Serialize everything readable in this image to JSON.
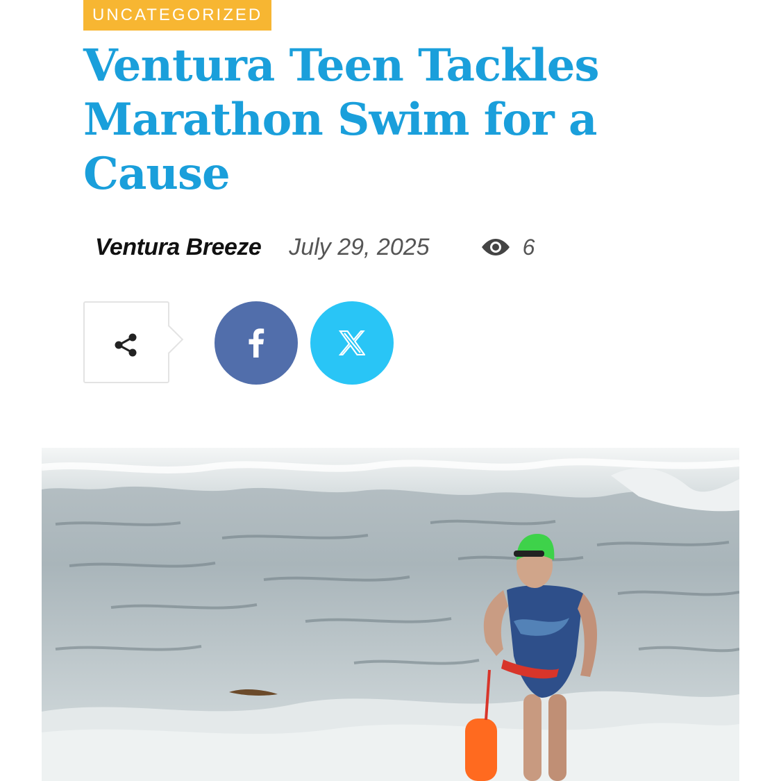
{
  "article": {
    "category": "UNCATEGORIZED",
    "title": "Ventura Teen Tackles Marathon Swim for a Cause",
    "author": "Ventura Breeze",
    "date": "July 29, 2025",
    "views": "6"
  },
  "share": {
    "share_icon": "share-icon",
    "facebook_icon": "facebook-icon",
    "x_icon": "x-icon"
  },
  "hero_image": {
    "alt": "photo"
  },
  "colors": {
    "category_bg": "#f7b632",
    "title": "#1a9fdb",
    "facebook": "#516eab",
    "x": "#29c5f6"
  }
}
